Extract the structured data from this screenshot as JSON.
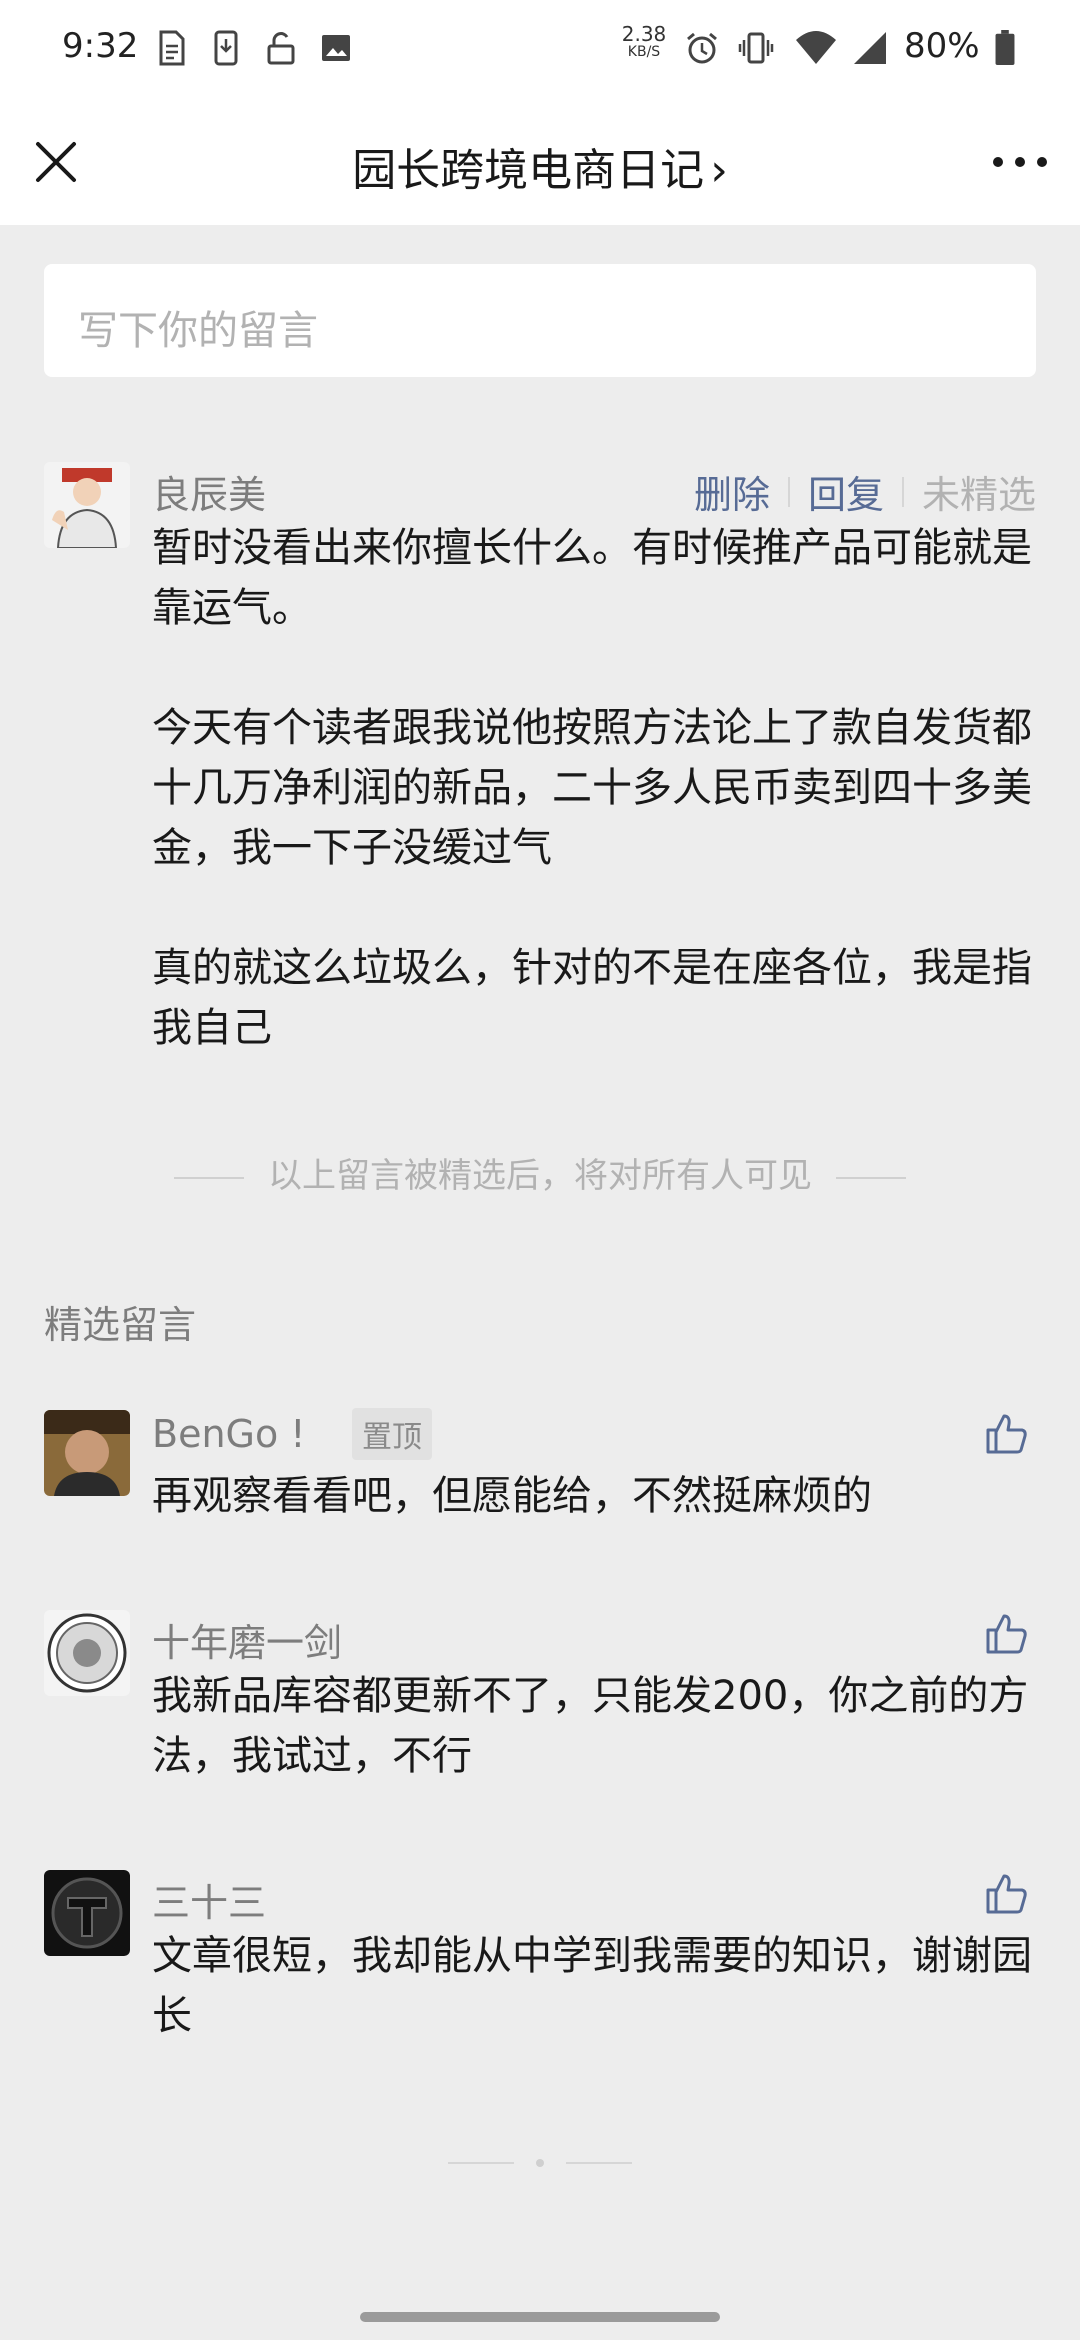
{
  "status_bar": {
    "time": "9:32",
    "net_speed_value": "2.38",
    "net_speed_unit": "KB/S",
    "battery": "80%",
    "icons": [
      "document-icon",
      "download-icon",
      "unlock-icon",
      "image-icon",
      "alarm-icon",
      "vibrate-icon",
      "wifi-icon",
      "signal-icon",
      "battery-icon"
    ]
  },
  "nav": {
    "title": "园长跨境电商日记",
    "chevron": "›"
  },
  "input": {
    "placeholder": "写下你的留言"
  },
  "my_comment": {
    "name": "良辰美",
    "actions": {
      "delete": "删除",
      "reply": "回复",
      "unfeatured": "未精选"
    },
    "text": "暂时没看出来你擅长什么。有时候推产品可能就是靠运气。\n\n今天有个读者跟我说他按照方法论上了款自发货都十几万净利润的新品，二十多人民币卖到四十多美金，我一下子没缓过气\n\n真的就这么垃圾么，针对的不是在座各位，我是指我自己"
  },
  "notice": "以上留言被精选后，将对所有人可见",
  "featured": {
    "title": "精选留言",
    "comments": [
      {
        "name": "BenGo !",
        "badge": "置顶",
        "text": "再观察看看吧，但愿能给，不然挺麻烦的"
      },
      {
        "name": "十年磨一剑",
        "text": "我新品库容都更新不了，只能发200，你之前的方法，我试过，不行"
      },
      {
        "name": "三十三",
        "text": "文章很短，我却能从中学到我需要的知识，谢谢园长"
      }
    ]
  },
  "colors": {
    "link": "#576b95",
    "muted": "#b2b2b2",
    "background": "#ededed"
  }
}
